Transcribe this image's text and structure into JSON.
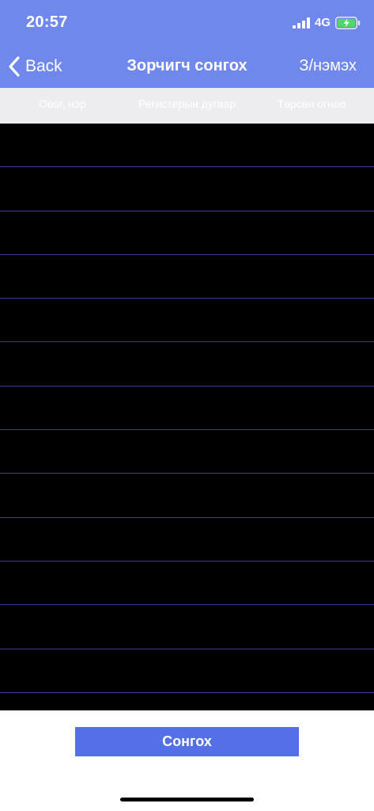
{
  "status_bar": {
    "time": "20:57",
    "network": "4G",
    "icons": [
      "signal-bars-icon",
      "battery-charging-icon"
    ]
  },
  "nav": {
    "back_label": "Back",
    "back_icon": "chevron-left-icon",
    "title": "Зорчигч сонгох",
    "action_label": "З/нэмэх"
  },
  "table": {
    "columns": [
      "Овог, нэр",
      "Регистерын дугаар",
      "Төрсөн огноо"
    ],
    "rows": [
      "",
      "",
      "",
      "",
      "",
      "",
      "",
      "",
      "",
      "",
      "",
      "",
      "",
      ""
    ]
  },
  "footer": {
    "select_label": "Сонгох"
  },
  "colors": {
    "header_bg": "#7088ec",
    "table_header_bg": "#ededf1",
    "list_bg": "#000000",
    "row_divider": "#3a3d8e",
    "button_bg": "#5470e6"
  }
}
